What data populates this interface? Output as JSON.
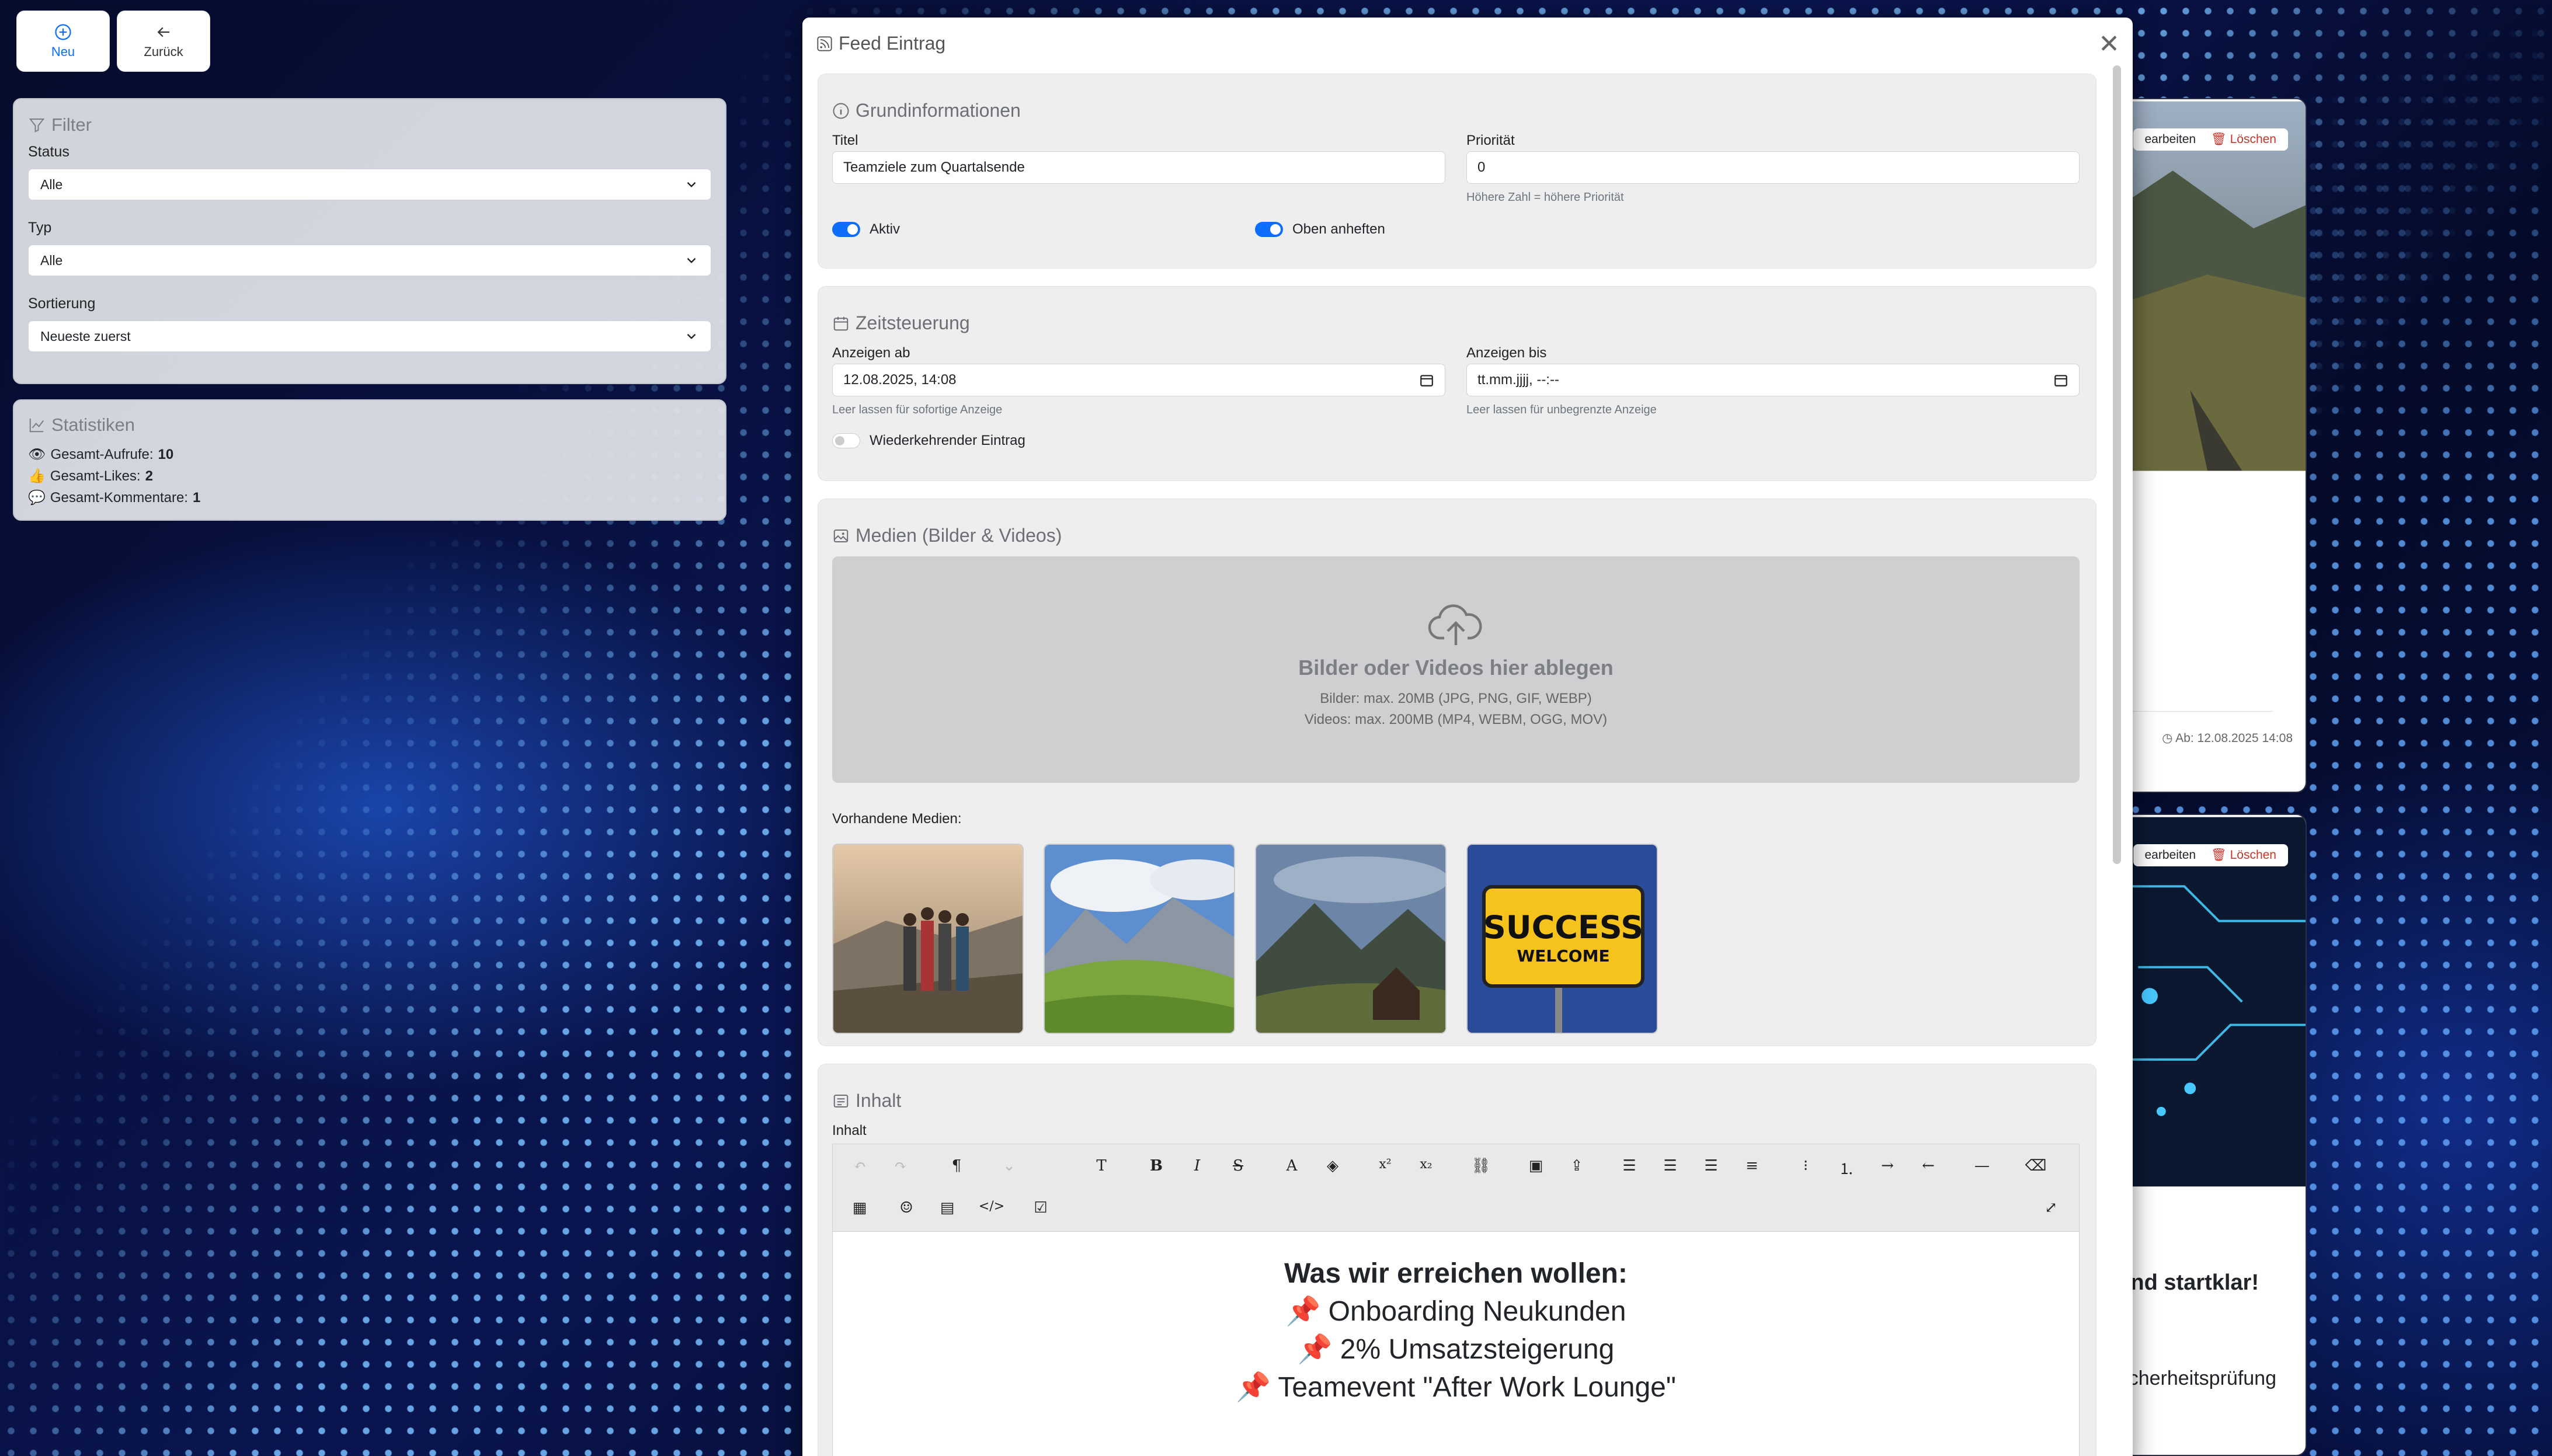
{
  "topbar": {
    "new_label": "Neu",
    "back_label": "Zurück"
  },
  "filter": {
    "title": "Filter",
    "status_label": "Status",
    "status_value": "Alle",
    "type_label": "Typ",
    "type_value": "Alle",
    "sort_label": "Sortierung",
    "sort_value": "Neueste zuerst"
  },
  "stats": {
    "title": "Statistiken",
    "views_label": "Gesamt-Aufrufe:",
    "views": "10",
    "likes_label": "Gesamt-Likes:",
    "likes": "2",
    "comments_label": "Gesamt-Kommentare:",
    "comments": "1"
  },
  "behind": {
    "edit_label": "earbeiten",
    "delete_label": "Löschen",
    "date_text": "Ab: 12.08.2025 14:08",
    "text1": "und startklar!",
    "text2": "cherheitsprüfung"
  },
  "modal": {
    "title": "Feed Eintrag",
    "basic": {
      "title": "Grundinformationen",
      "titel_label": "Titel",
      "titel_value": "Teamziele zum Quartalsende",
      "prio_label": "Priorität",
      "prio_value": "0",
      "prio_help": "Höhere Zahl = höhere Priorität",
      "active_label": "Aktiv",
      "pin_label": "Oben anheften"
    },
    "schedule": {
      "title": "Zeitsteuerung",
      "from_label": "Anzeigen ab",
      "from_value": "12.08.2025, 14:08",
      "from_help": "Leer lassen für sofortige Anzeige",
      "to_label": "Anzeigen bis",
      "to_value": "tt.mm.jjjj, --:--",
      "to_help": "Leer lassen für unbegrenzte Anzeige",
      "recurring_label": "Wiederkehrender Eintrag"
    },
    "media": {
      "title": "Medien (Bilder & Videos)",
      "drop_title": "Bilder oder Videos hier ablegen",
      "drop_images": "Bilder: max. 20MB (JPG, PNG, GIF, WEBP)",
      "drop_videos": "Videos: max. 200MB (MP4, WEBM, OGG, MOV)",
      "existing_label": "Vorhandene Medien:",
      "success_sign": "SUCCESS",
      "welcome_sign": "WELCOME"
    },
    "content": {
      "title": "Inhalt",
      "field_label": "Inhalt",
      "heading": "Was wir erreichen wollen:",
      "line1": "📌 Onboarding Neukunden",
      "line2": "📌 2% Umsatzsteigerung",
      "line3": "📌 Teamevent \"After Work Lounge\""
    }
  },
  "colors": {
    "accent": "#0d6efd",
    "delete": "#c0392b"
  }
}
